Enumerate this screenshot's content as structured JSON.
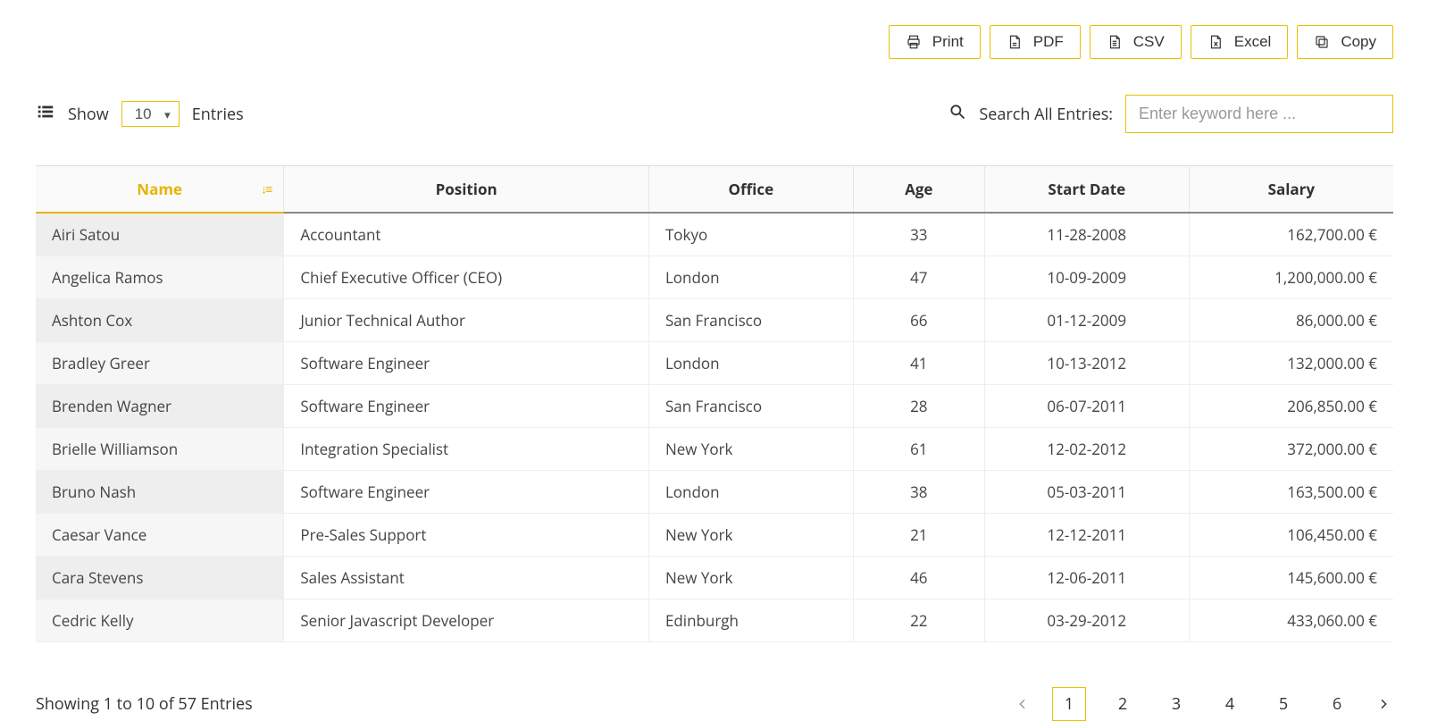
{
  "export": {
    "print": "Print",
    "pdf": "PDF",
    "csv": "CSV",
    "excel": "Excel",
    "copy": "Copy"
  },
  "length": {
    "show": "Show",
    "value": "10",
    "entries": "Entries"
  },
  "search": {
    "label": "Search All Entries:",
    "placeholder": "Enter keyword here ..."
  },
  "columns": {
    "name": "Name",
    "position": "Position",
    "office": "Office",
    "age": "Age",
    "start": "Start Date",
    "salary": "Salary"
  },
  "rows": [
    {
      "name": "Airi Satou",
      "position": "Accountant",
      "office": "Tokyo",
      "age": "33",
      "start": "11-28-2008",
      "salary": "162,700.00 €"
    },
    {
      "name": "Angelica Ramos",
      "position": "Chief Executive Officer (CEO)",
      "office": "London",
      "age": "47",
      "start": "10-09-2009",
      "salary": "1,200,000.00 €"
    },
    {
      "name": "Ashton Cox",
      "position": "Junior Technical Author",
      "office": "San Francisco",
      "age": "66",
      "start": "01-12-2009",
      "salary": "86,000.00 €"
    },
    {
      "name": "Bradley Greer",
      "position": "Software Engineer",
      "office": "London",
      "age": "41",
      "start": "10-13-2012",
      "salary": "132,000.00 €"
    },
    {
      "name": "Brenden Wagner",
      "position": "Software Engineer",
      "office": "San Francisco",
      "age": "28",
      "start": "06-07-2011",
      "salary": "206,850.00 €"
    },
    {
      "name": "Brielle Williamson",
      "position": "Integration Specialist",
      "office": "New York",
      "age": "61",
      "start": "12-02-2012",
      "salary": "372,000.00 €"
    },
    {
      "name": "Bruno Nash",
      "position": "Software Engineer",
      "office": "London",
      "age": "38",
      "start": "05-03-2011",
      "salary": "163,500.00 €"
    },
    {
      "name": "Caesar Vance",
      "position": "Pre-Sales Support",
      "office": "New York",
      "age": "21",
      "start": "12-12-2011",
      "salary": "106,450.00 €"
    },
    {
      "name": "Cara Stevens",
      "position": "Sales Assistant",
      "office": "New York",
      "age": "46",
      "start": "12-06-2011",
      "salary": "145,600.00 €"
    },
    {
      "name": "Cedric Kelly",
      "position": "Senior Javascript Developer",
      "office": "Edinburgh",
      "age": "22",
      "start": "03-29-2012",
      "salary": "433,060.00 €"
    }
  ],
  "info": "Showing 1 to 10 of 57 Entries",
  "pages": [
    "1",
    "2",
    "3",
    "4",
    "5",
    "6"
  ],
  "active_page": "1"
}
